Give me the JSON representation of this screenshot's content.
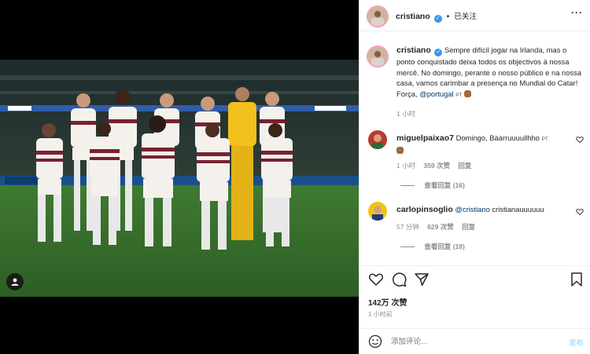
{
  "post": {
    "username": "cristiano",
    "follow_state": "已关注",
    "more": "···"
  },
  "caption": {
    "username": "cristiano",
    "text": "Sempre difícil jogar na Irlanda, mas o ponto conquistado deixa todos os objectivos à nossa mercê. No domingo, perante o nosso público e na nossa casa, vamos carimbar a presença no Mundial do Catar! Força,",
    "mention": "@portugal",
    "flag": "PT",
    "time": "1 小时"
  },
  "comments": [
    {
      "username": "miguelpaixao7",
      "text": "Domingo, Bààrruuuullhho",
      "flag": "PT",
      "time": "1 小时",
      "likes": "359 次赞",
      "reply": "回复",
      "view_replies": "查看回复 (16)"
    },
    {
      "username": "carlopinsoglio",
      "mention": "@cristiano",
      "text": "cristianauuuuuu",
      "time": "57 分钟",
      "likes": "629 次赞",
      "reply": "回复",
      "view_replies": "查看回复 (18)"
    }
  ],
  "stats": {
    "likes": "142万 次赞",
    "posted": "1 小时前"
  },
  "composer": {
    "placeholder": "添加评论...",
    "post_label": "发布"
  },
  "colors": {
    "verified": "#3897f0",
    "link": "#00376b",
    "post_button": "#b2dffc"
  },
  "icons": [
    "heart-icon",
    "comment-icon",
    "share-icon",
    "bookmark-icon",
    "emoji-icon",
    "tag-user-icon",
    "more-icon",
    "verified-icon"
  ]
}
